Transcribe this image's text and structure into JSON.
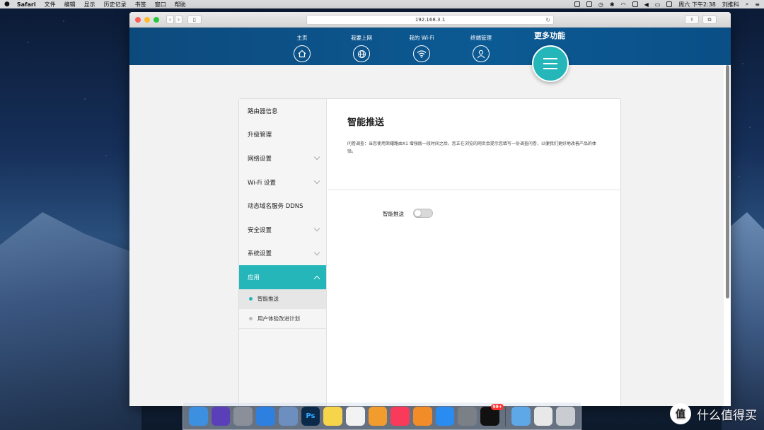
{
  "menubar": {
    "apple": "",
    "app": "Safari",
    "items": [
      "文件",
      "编辑",
      "显示",
      "历史记录",
      "书签",
      "窗口",
      "帮助"
    ],
    "clock": "周六 下午2:38",
    "user": "刘推科"
  },
  "browser": {
    "url": "192.168.3.1",
    "back": "‹",
    "forward": "›",
    "reload": "↻"
  },
  "router_nav": {
    "items": [
      {
        "label": "主页",
        "icon": "home-icon"
      },
      {
        "label": "我要上网",
        "icon": "globe-icon"
      },
      {
        "label": "我的 Wi-Fi",
        "icon": "wifi-icon"
      },
      {
        "label": "终端管理",
        "icon": "user-icon"
      }
    ],
    "more_label": "更多功能"
  },
  "sidebar": {
    "items": [
      {
        "label": "路由器信息",
        "expandable": false
      },
      {
        "label": "升级管理",
        "expandable": false
      },
      {
        "label": "网络设置",
        "expandable": true
      },
      {
        "label": "Wi-Fi 设置",
        "expandable": true
      },
      {
        "label": "动态域名服务 DDNS",
        "expandable": false
      },
      {
        "label": "安全设置",
        "expandable": true
      },
      {
        "label": "系统设置",
        "expandable": true
      },
      {
        "label": "应用",
        "expandable": true,
        "active": true
      }
    ],
    "subitems": [
      {
        "label": "智能推送",
        "selected": true
      },
      {
        "label": "用户体验改进计划",
        "selected": false
      }
    ]
  },
  "main": {
    "title": "智能推送",
    "description": "问卷调查：当您使用荣耀路由X1 增强版一段时间之后，您正在浏览的网页会提示您填写一份调查问卷，以便我们更好地改善产品的体验。",
    "toggle_label": "智能推送",
    "toggle_on": false
  },
  "dock": {
    "apps": [
      {
        "name": "finder",
        "color": "#3d8fe0",
        "glyph": ""
      },
      {
        "name": "siri",
        "color": "#5a3fb8",
        "glyph": ""
      },
      {
        "name": "launchpad",
        "color": "#8a8f99",
        "glyph": ""
      },
      {
        "name": "safari",
        "color": "#2d7fe0",
        "glyph": ""
      },
      {
        "name": "preview",
        "color": "#6c8fbf",
        "glyph": ""
      },
      {
        "name": "photoshop",
        "color": "#0b2a4a",
        "glyph": "Ps"
      },
      {
        "name": "notes",
        "color": "#f7d54a",
        "glyph": ""
      },
      {
        "name": "photos",
        "color": "#f2f2f2",
        "glyph": ""
      },
      {
        "name": "pages",
        "color": "#f39c2e",
        "glyph": ""
      },
      {
        "name": "music",
        "color": "#fa3a5a",
        "glyph": ""
      },
      {
        "name": "books",
        "color": "#f28c28",
        "glyph": ""
      },
      {
        "name": "app-store",
        "color": "#2a8cf0",
        "glyph": ""
      },
      {
        "name": "system-preferences",
        "color": "#7b7f86",
        "glyph": ""
      },
      {
        "name": "qq",
        "color": "#111111",
        "glyph": ""
      },
      {
        "name": "downloads",
        "color": "#5fa8e8",
        "glyph": ""
      },
      {
        "name": "document",
        "color": "#e8e8e8",
        "glyph": ""
      },
      {
        "name": "trash",
        "color": "#c9ccd1",
        "glyph": ""
      }
    ],
    "qq_badge": "99+"
  },
  "watermark": {
    "logo": "值",
    "text": "什么值得买"
  },
  "colors": {
    "accent": "#24b6b8",
    "header": "#0c5a94"
  }
}
